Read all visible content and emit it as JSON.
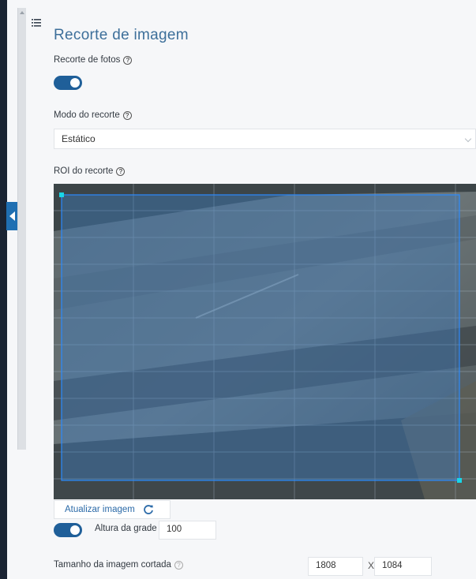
{
  "panel": {
    "title": "Recorte de imagem",
    "photo_crop": {
      "label": "Recorte de fotos",
      "enabled": true
    },
    "crop_mode": {
      "label": "Modo do recorte",
      "selected": "Estático"
    },
    "roi": {
      "label": "ROI do recorte"
    },
    "update_button": {
      "label": "Atualizar imagem"
    },
    "grid": {
      "label": "Altura da grade",
      "enabled": true,
      "value": "100"
    },
    "cropped_size": {
      "label": "Tamanho da imagem cortada",
      "width": "1808",
      "separator": "X",
      "height": "1084"
    }
  },
  "colors": {
    "accent": "#1f5f99",
    "title": "#3d6f9a",
    "roi_overlay": "#3f7fc4",
    "roi_handle": "#19d6e6",
    "nav": "#1a2433"
  },
  "icons": {
    "menu": "list-icon",
    "collapse": "chevron-left-icon",
    "help": "help-circle-icon",
    "refresh": "refresh-icon",
    "dropdown": "chevron-down-icon"
  }
}
